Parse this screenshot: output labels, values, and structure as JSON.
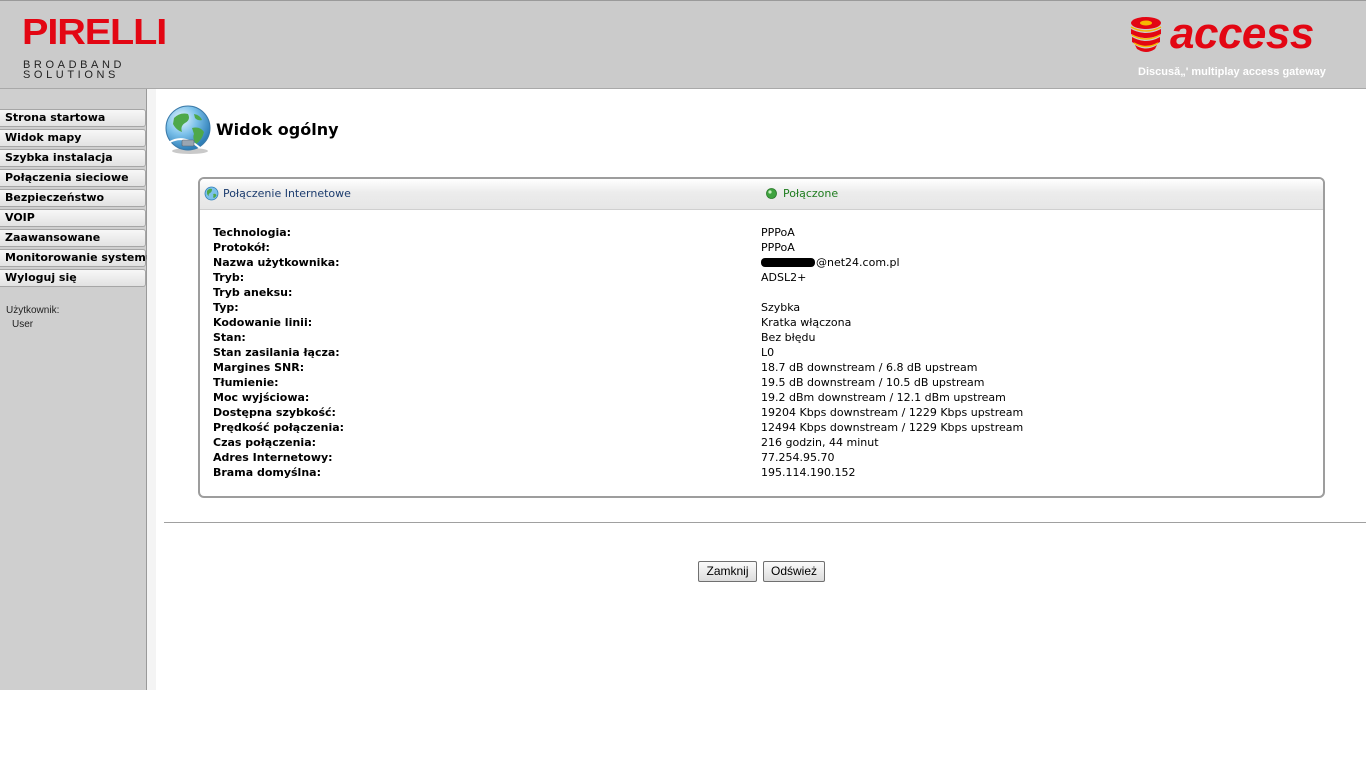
{
  "header": {
    "brand_main": "PIRELLI",
    "brand_sub_1": "BROADBAND",
    "brand_sub_2": "SOLUTIONS",
    "product_name": "access",
    "tagline": "Discusă„' multiplay access gateway"
  },
  "sidebar": {
    "items": [
      {
        "label": "Strona startowa"
      },
      {
        "label": "Widok mapy"
      },
      {
        "label": "Szybka instalacja"
      },
      {
        "label": "Połączenia sieciowe"
      },
      {
        "label": "Bezpieczeństwo"
      },
      {
        "label": "VOIP"
      },
      {
        "label": "Zaawansowane"
      },
      {
        "label": "Monitorowanie systemu"
      },
      {
        "label": "Wyloguj się"
      }
    ],
    "user_label": "Użytkownik:",
    "user_value": "User"
  },
  "main": {
    "title": "Widok ogólny",
    "panel": {
      "title": "Połączenie Internetowe",
      "status": "Połączone",
      "rows": [
        {
          "label": "Technologia:",
          "value": "PPPoA"
        },
        {
          "label": "Protokół:",
          "value": "PPPoA"
        },
        {
          "label": "Nazwa użytkownika:",
          "value": "@net24.com.pl"
        },
        {
          "label": "Tryb:",
          "value": "ADSL2+"
        },
        {
          "label": "Tryb aneksu:",
          "value": ""
        },
        {
          "label": "Typ:",
          "value": "Szybka"
        },
        {
          "label": "Kodowanie linii:",
          "value": "Kratka włączona"
        },
        {
          "label": "Stan:",
          "value": "Bez błędu"
        },
        {
          "label": "Stan zasilania łącza:",
          "value": "L0"
        },
        {
          "label": "Margines SNR:",
          "value": "18.7 dB downstream / 6.8 dB upstream"
        },
        {
          "label": "Tłumienie:",
          "value": "19.5 dB downstream / 10.5 dB upstream"
        },
        {
          "label": "Moc wyjściowa:",
          "value": "19.2 dBm downstream / 12.1 dBm upstream"
        },
        {
          "label": "Dostępna szybkość:",
          "value": "19204 Kbps downstream / 1229 Kbps upstream"
        },
        {
          "label": "Prędkość połączenia:",
          "value": "12494 Kbps downstream / 1229 Kbps upstream"
        },
        {
          "label": "Czas połączenia:",
          "value": "216 godzin, 44 minut"
        },
        {
          "label": "Adres Internetowy:",
          "value": "77.254.95.70"
        },
        {
          "label": "Brama domyślna:",
          "value": "195.114.190.152"
        }
      ]
    },
    "buttons": {
      "close": "Zamknij",
      "refresh": "Odśwież"
    }
  },
  "colors": {
    "brand_red": "#e30613",
    "status_green": "#1e7c1e",
    "link_blue": "#1c3c6e"
  }
}
